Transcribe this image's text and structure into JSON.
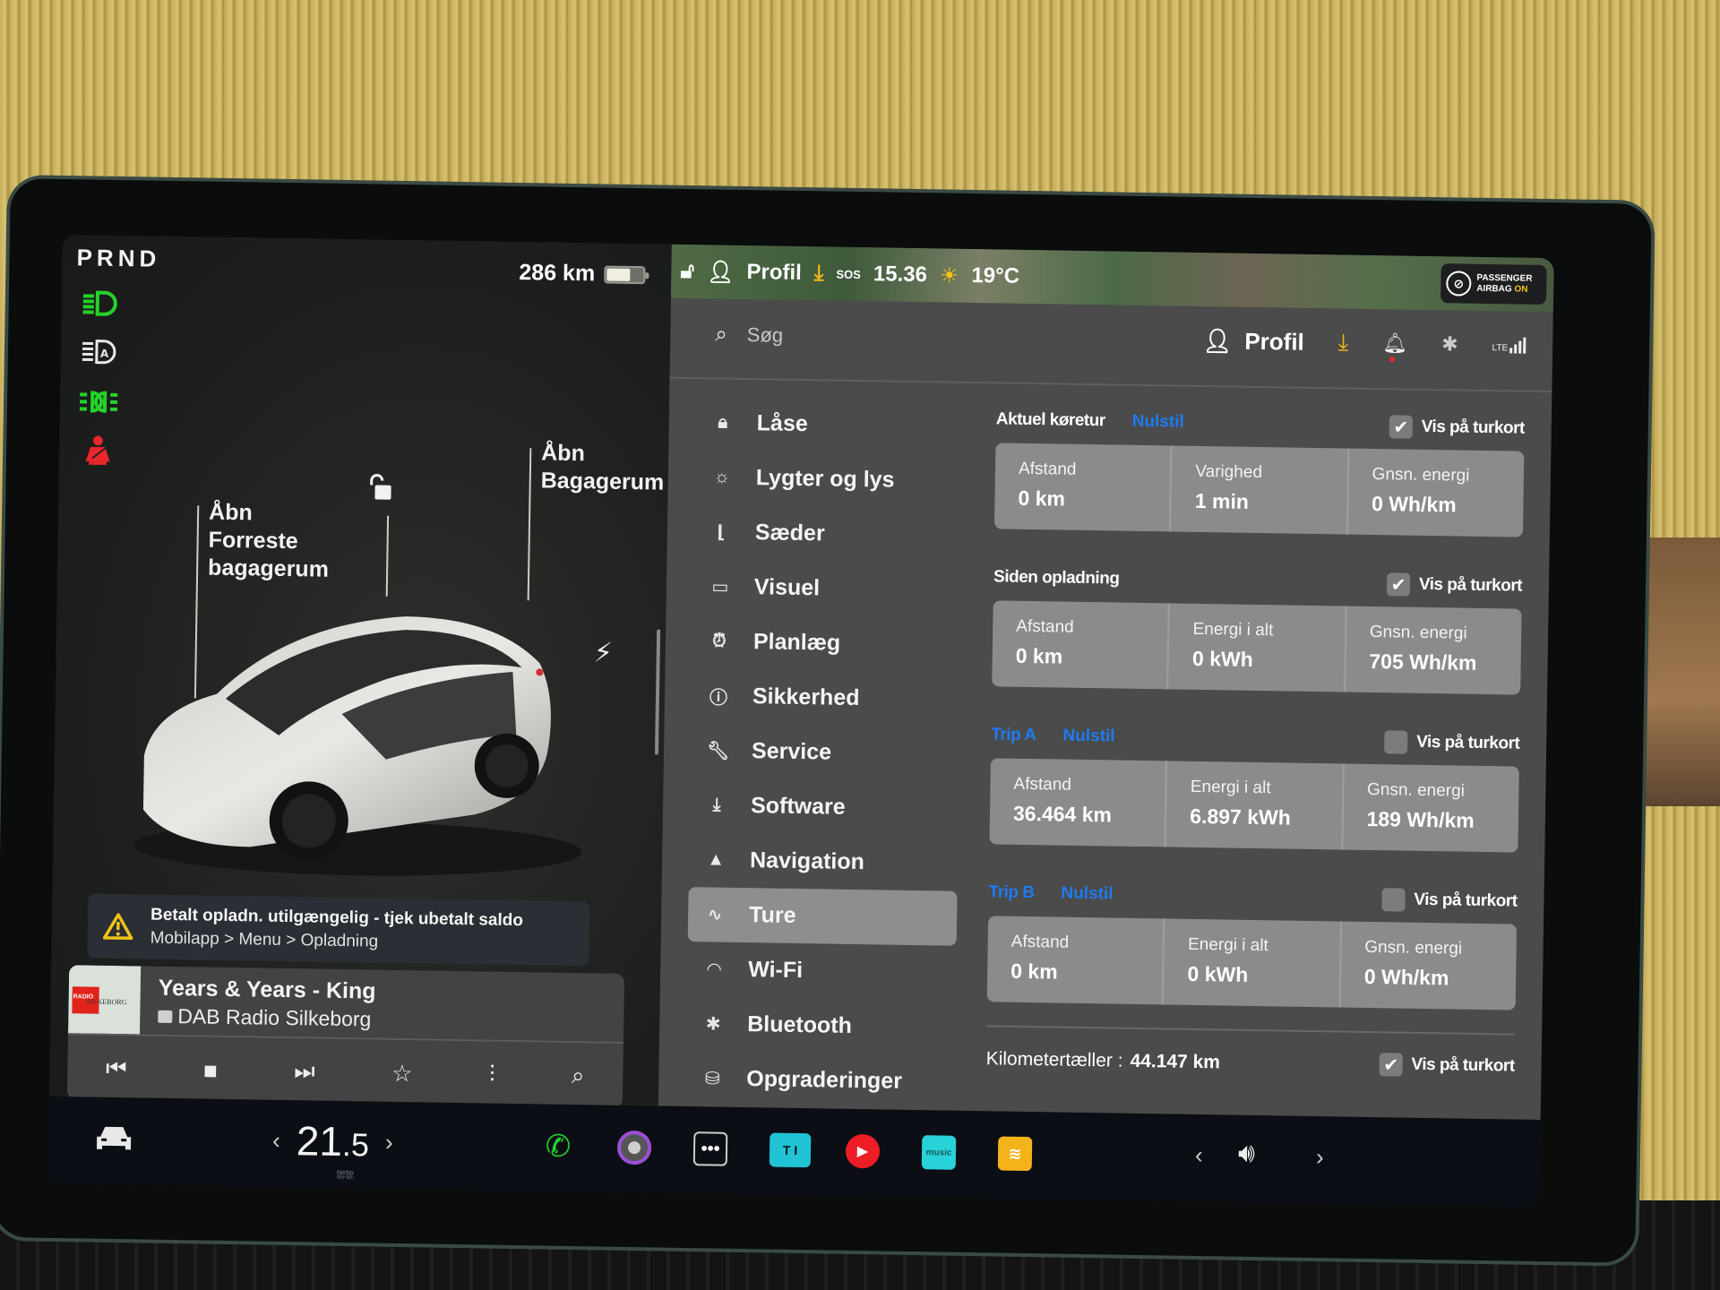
{
  "left_panel": {
    "gear": "PRND",
    "range": "286 km",
    "battery_level": 0.62,
    "telltales": [
      "low-beam-icon",
      "auto-high-beam-icon",
      "parking-lights-icon",
      "seatbelt-warning-icon"
    ],
    "colors": {
      "telltale_green": "#25d12b",
      "telltale_red": "#e8262b",
      "telltale_white": "#e8e8e8"
    },
    "frunk": {
      "line1": "Åbn",
      "line2": "Forreste",
      "line3": "bagagerum"
    },
    "trunk": {
      "line1": "Åbn",
      "line2": "Bagagerum"
    },
    "lock_state": "unlocked",
    "charge_port_icon": "lightning-icon",
    "alert": {
      "title": "Betalt opladn. utilgængelig - tjek ubetalt saldo",
      "subtitle": "Mobilapp > Menu > Opladning"
    },
    "media": {
      "art_text_1": "RADIO",
      "art_text_2": "SILKEBORG",
      "title": "Years & Years - King",
      "source": "DAB Radio Silkeborg",
      "controls": [
        "previous-icon",
        "stop-icon",
        "next-icon",
        "favorite-icon",
        "equalizer-icon",
        "search-icon"
      ],
      "pages": 3,
      "active_page": 1
    }
  },
  "status_bar": {
    "profile": "Profil",
    "sos": "SOS",
    "time": "15.36",
    "temperature": "19°C",
    "airbag_line1": "PASSENGER",
    "airbag_line2": "AIRBAG",
    "airbag_state": "ON"
  },
  "topbar": {
    "search_placeholder": "Søg",
    "profile_label": "Profil",
    "download_color": "#f2b519",
    "notification_dot_color": "#e8262b",
    "network": "LTE"
  },
  "nav": {
    "items": [
      {
        "label": "Låse",
        "icon": "lock-icon",
        "glyph": "🔒︎"
      },
      {
        "label": "Lygter og lys",
        "icon": "light-icon",
        "glyph": "☼"
      },
      {
        "label": "Sæder",
        "icon": "seat-icon",
        "glyph": "⌊"
      },
      {
        "label": "Visuel",
        "icon": "display-icon",
        "glyph": "▭"
      },
      {
        "label": "Planlæg",
        "icon": "alarm-clock-icon",
        "glyph": "⏰︎"
      },
      {
        "label": "Sikkerhed",
        "icon": "warning-circle-icon",
        "glyph": "ⓘ"
      },
      {
        "label": "Service",
        "icon": "wrench-icon",
        "glyph": "🔧︎"
      },
      {
        "label": "Software",
        "icon": "download-icon",
        "glyph": "⤓"
      },
      {
        "label": "Navigation",
        "icon": "navigation-arrow-icon",
        "glyph": "▲"
      },
      {
        "label": "Ture",
        "icon": "trips-icon",
        "glyph": "∿"
      },
      {
        "label": "Wi-Fi",
        "icon": "wifi-icon",
        "glyph": "◠"
      },
      {
        "label": "Bluetooth",
        "icon": "bluetooth-icon",
        "glyph": "✱"
      },
      {
        "label": "Opgraderinger",
        "icon": "shopping-bag-icon",
        "glyph": "⛁"
      }
    ],
    "active": "Ture"
  },
  "trips": {
    "current": {
      "title": "Aktuel køretur",
      "reset": "Nulstil",
      "show_label": "Vis på turkort",
      "show_checked": true,
      "cells": [
        {
          "label": "Afstand",
          "value": "0 km"
        },
        {
          "label": "Varighed",
          "value": "1 min"
        },
        {
          "label": "Gnsn. energi",
          "value": "0 Wh/km"
        }
      ]
    },
    "since_charge": {
      "title": "Siden opladning",
      "show_label": "Vis på turkort",
      "show_checked": true,
      "cells": [
        {
          "label": "Afstand",
          "value": "0 km"
        },
        {
          "label": "Energi i alt",
          "value": "0 kWh"
        },
        {
          "label": "Gnsn. energi",
          "value": "705 Wh/km"
        }
      ]
    },
    "trip_a": {
      "title": "Trip A",
      "reset": "Nulstil",
      "show_label": "Vis på turkort",
      "show_checked": false,
      "cells": [
        {
          "label": "Afstand",
          "value": "36.464 km"
        },
        {
          "label": "Energi i alt",
          "value": "6.897 kWh"
        },
        {
          "label": "Gnsn. energi",
          "value": "189 Wh/km"
        }
      ]
    },
    "trip_b": {
      "title": "Trip B",
      "reset": "Nulstil",
      "show_label": "Vis på turkort",
      "show_checked": false,
      "cells": [
        {
          "label": "Afstand",
          "value": "0 km"
        },
        {
          "label": "Energi i alt",
          "value": "0 kWh"
        },
        {
          "label": "Gnsn. energi",
          "value": "0 Wh/km"
        }
      ]
    },
    "odometer": {
      "label": "Kilometertæller :",
      "value": "44.147 km",
      "show_label": "Vis på turkort",
      "show_checked": true
    },
    "accent_color": "#1f7bf2"
  },
  "bottom_bar": {
    "temp_whole": "21",
    "temp_decimal": ".5",
    "apps": [
      {
        "name": "phone-app",
        "color": "#22d02a"
      },
      {
        "name": "camera-app",
        "color": "#9b4fd6"
      },
      {
        "name": "more-apps",
        "color": "#e8e8e8"
      },
      {
        "name": "toybox-app",
        "color": "#1fc3d3"
      },
      {
        "name": "youtube-music-app",
        "color": "#ee1c25"
      },
      {
        "name": "amazon-music-app",
        "color": "#27d3d8",
        "text": "music"
      },
      {
        "name": "audible-app",
        "color": "#f4b31a"
      }
    ]
  }
}
